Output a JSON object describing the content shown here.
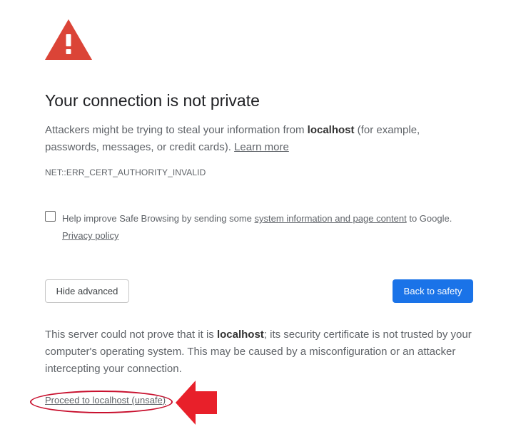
{
  "title": "Your connection is not private",
  "main_message": {
    "before": "Attackers might be trying to steal your information from ",
    "host": "localhost",
    "after": " (for example, passwords, messages, or credit cards). ",
    "learn_more": "Learn more"
  },
  "error_code": "NET::ERR_CERT_AUTHORITY_INVALID",
  "safe_browsing": {
    "checked": false,
    "text_before": "Help improve Safe Browsing by sending some ",
    "link": "system information and page content",
    "text_after": " to Google. ",
    "privacy_link": "Privacy policy"
  },
  "buttons": {
    "hide_advanced": "Hide advanced",
    "back_to_safety": "Back to safety"
  },
  "details": {
    "before": "This server could not prove that it is ",
    "host": "localhost",
    "after": "; its security certificate is not trusted by your computer's operating system. This may be caused by a misconfiguration or an attacker intercepting your connection."
  },
  "proceed_link": "Proceed to localhost (unsafe)",
  "icons": {
    "warning": "warning-triangle-icon",
    "annotation_arrow": "red-arrow-icon"
  },
  "colors": {
    "warning_red": "#db4437",
    "primary_blue": "#1a73e8",
    "annotation_red": "#e8202a"
  }
}
